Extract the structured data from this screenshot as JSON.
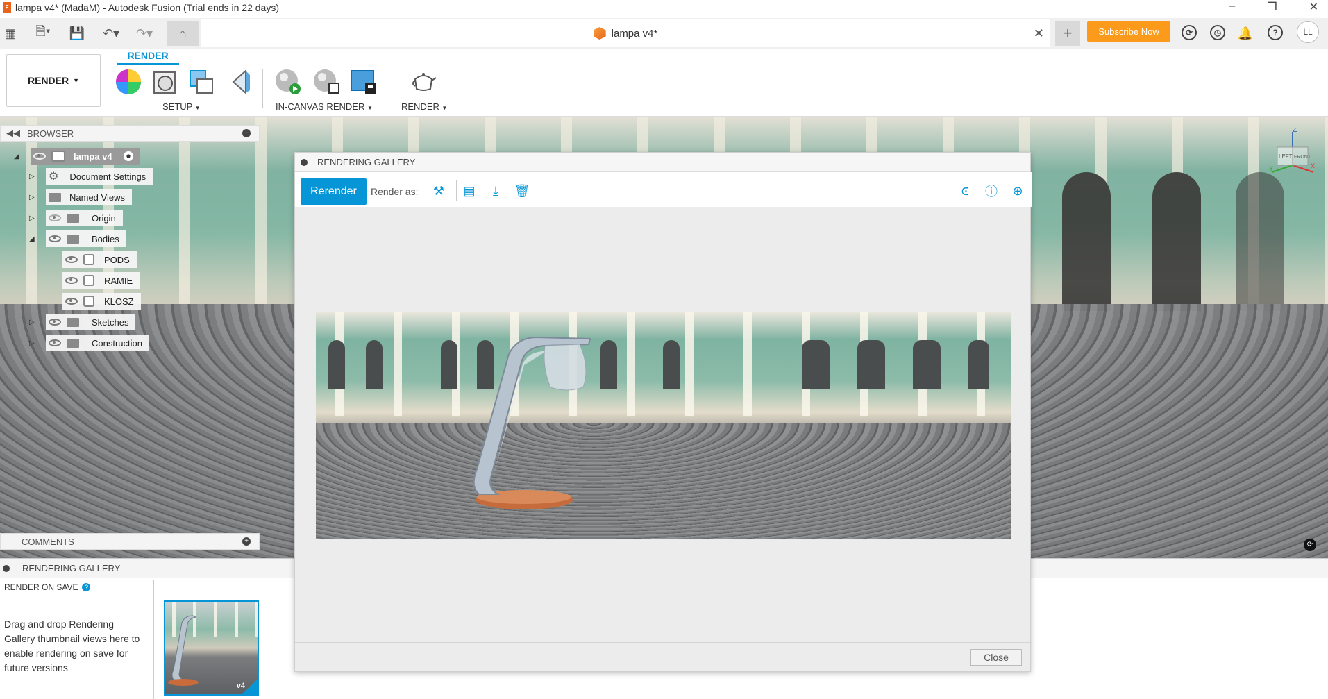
{
  "window": {
    "title": "lampa v4* (MadaM) - Autodesk Fusion (Trial ends in 22 days)",
    "app_icon_letter": "F",
    "controls": [
      "minimize-icon",
      "restore-icon",
      "close-icon"
    ]
  },
  "tabs": {
    "document_title": "lampa v4*",
    "subscribe_label": "Subscribe Now",
    "user_initials": "LL"
  },
  "ribbon": {
    "workspace_label": "RENDER",
    "active_tab": "RENDER",
    "groups": {
      "setup": "SETUP",
      "in_canvas": "IN-CANVAS RENDER",
      "render": "RENDER"
    }
  },
  "browser": {
    "header": "BROWSER",
    "root": "lampa v4",
    "items": {
      "document_settings": "Document Settings",
      "named_views": "Named Views",
      "origin": "Origin",
      "bodies": "Bodies",
      "pods": "PODS",
      "ramie": "RAMIE",
      "klosz": "KLOSZ",
      "sketches": "Sketches",
      "construction": "Construction"
    }
  },
  "comments": {
    "header": "COMMENTS"
  },
  "viewcube": {
    "top": "Z",
    "left": "LEFT",
    "front": "FRONT",
    "x": "X",
    "y": "Y"
  },
  "gallery_dialog": {
    "title": "RENDERING GALLERY",
    "rerender_label": "Rerender",
    "render_as_label": "Render as:",
    "close_label": "Close"
  },
  "bottom_gallery": {
    "title": "RENDERING GALLERY",
    "render_on_save": "RENDER ON SAVE",
    "hint": "Drag and drop Rendering Gallery thumbnail views here to enable rendering on save for future versions",
    "thumb_badge": "v4"
  },
  "colors": {
    "accent": "#0696d7",
    "subscribe": "#fb9a1b",
    "brand_orange": "#e8641d"
  }
}
